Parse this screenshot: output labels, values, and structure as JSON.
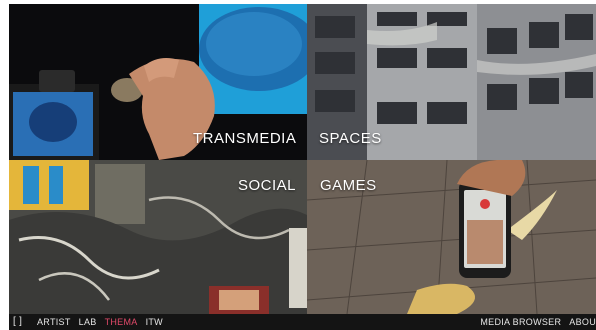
{
  "tiles": {
    "transmedia": "TRANSMEDIA",
    "spaces": "SPACES",
    "social": "SOCIAL",
    "games": "GAMES"
  },
  "nav": {
    "logo_icon": "brackets-logo-icon",
    "items": [
      "ARTIST",
      "LAB",
      "THEMA",
      "ITW"
    ],
    "active": "THEMA",
    "right_items": [
      "MEDIA BROWSER",
      "ABOU"
    ]
  },
  "colors": {
    "active_nav": "#e24a6a",
    "bar_bg": "#141414"
  }
}
